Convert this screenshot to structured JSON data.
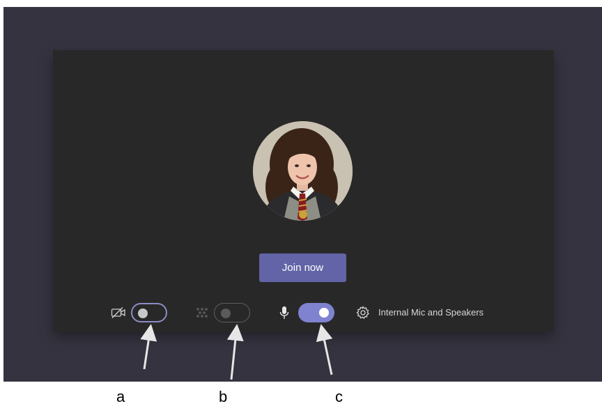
{
  "prejoin": {
    "join_label": "Join now",
    "device_label": "Internal Mic and Speakers"
  },
  "controls": {
    "video_toggle": {
      "state": "off",
      "icon": "camera-off-icon"
    },
    "background_toggle": {
      "state": "off",
      "disabled": true,
      "icon": "background-effects-icon"
    },
    "mic_toggle": {
      "state": "on",
      "icon": "microphone-icon"
    },
    "settings_icon": "gear-icon"
  },
  "annotations": {
    "a": "a",
    "b": "b",
    "c": "c"
  },
  "colors": {
    "accent": "#6264a7",
    "toggle_on": "#7f83cf",
    "panel_bg": "#282828",
    "screen_bg": "#35333f"
  }
}
